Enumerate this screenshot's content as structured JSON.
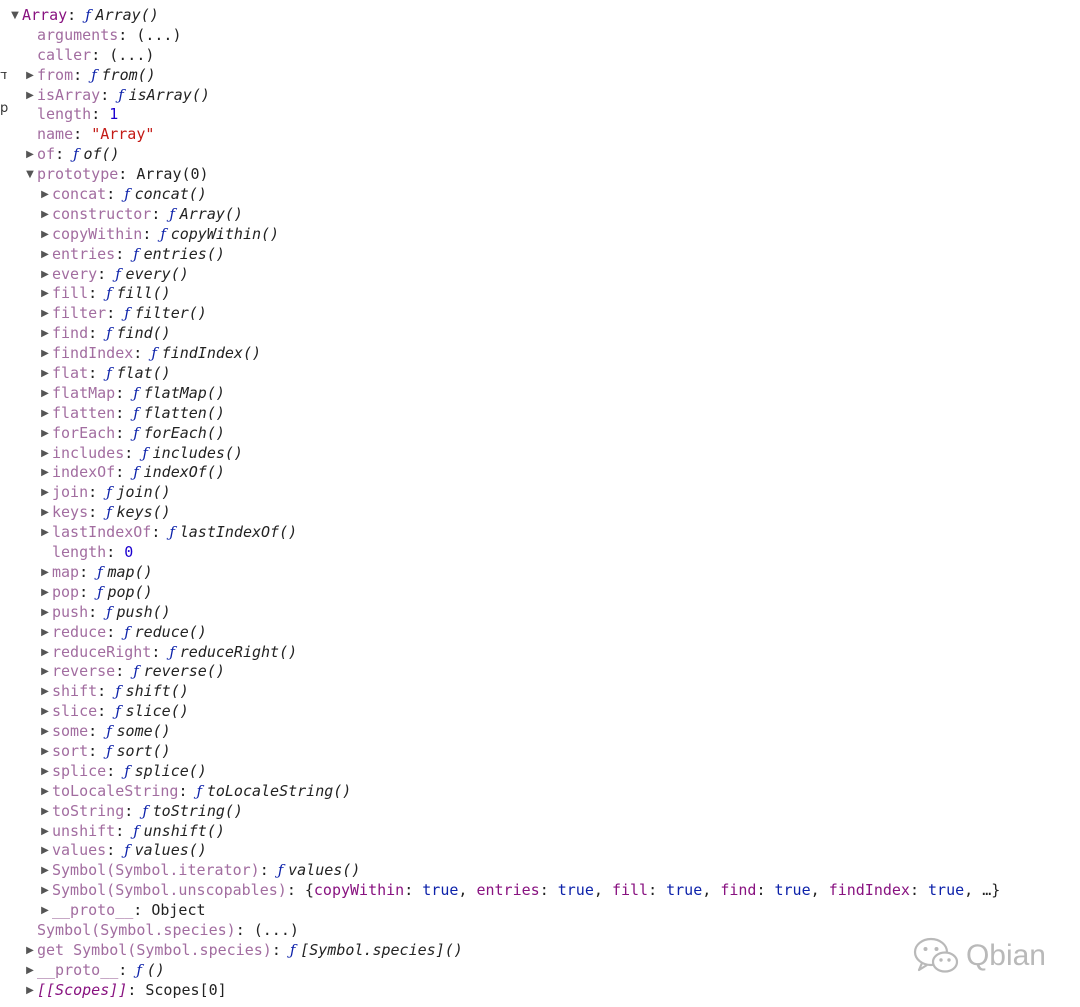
{
  "edge": [
    "ד",
    "p"
  ],
  "watermark": {
    "text": "Qbian",
    "icon": "wechat-icon"
  },
  "rows": [
    {
      "indent": 0,
      "arrow": "open",
      "key": "Array",
      "style": "enum",
      "value": [
        [
          "fsym",
          "ƒ "
        ],
        [
          "fname",
          "Array()"
        ]
      ]
    },
    {
      "indent": 1,
      "arrow": "none",
      "key": "arguments",
      "style": "nonenum",
      "value": [
        [
          "plain",
          "(...)"
        ]
      ]
    },
    {
      "indent": 1,
      "arrow": "none",
      "key": "caller",
      "style": "nonenum",
      "value": [
        [
          "plain",
          "(...)"
        ]
      ]
    },
    {
      "indent": 1,
      "arrow": "closed",
      "key": "from",
      "style": "nonenum",
      "value": [
        [
          "fsym",
          "ƒ "
        ],
        [
          "fname",
          "from()"
        ]
      ]
    },
    {
      "indent": 1,
      "arrow": "closed",
      "key": "isArray",
      "style": "nonenum",
      "value": [
        [
          "fsym",
          "ƒ "
        ],
        [
          "fname",
          "isArray()"
        ]
      ]
    },
    {
      "indent": 1,
      "arrow": "none",
      "key": "length",
      "style": "nonenum",
      "value": [
        [
          "num",
          "1"
        ]
      ]
    },
    {
      "indent": 1,
      "arrow": "none",
      "key": "name",
      "style": "nonenum",
      "value": [
        [
          "str",
          "\"Array\""
        ]
      ]
    },
    {
      "indent": 1,
      "arrow": "closed",
      "key": "of",
      "style": "nonenum",
      "value": [
        [
          "fsym",
          "ƒ "
        ],
        [
          "fname",
          "of()"
        ]
      ]
    },
    {
      "indent": 1,
      "arrow": "open",
      "key": "prototype",
      "style": "nonenum",
      "value": [
        [
          "plain",
          "Array(0)"
        ]
      ]
    },
    {
      "indent": 2,
      "arrow": "closed",
      "key": "concat",
      "style": "nonenum",
      "value": [
        [
          "fsym",
          "ƒ "
        ],
        [
          "fname",
          "concat()"
        ]
      ]
    },
    {
      "indent": 2,
      "arrow": "closed",
      "key": "constructor",
      "style": "nonenum",
      "value": [
        [
          "fsym",
          "ƒ "
        ],
        [
          "fname",
          "Array()"
        ]
      ]
    },
    {
      "indent": 2,
      "arrow": "closed",
      "key": "copyWithin",
      "style": "nonenum",
      "value": [
        [
          "fsym",
          "ƒ "
        ],
        [
          "fname",
          "copyWithin()"
        ]
      ]
    },
    {
      "indent": 2,
      "arrow": "closed",
      "key": "entries",
      "style": "nonenum",
      "value": [
        [
          "fsym",
          "ƒ "
        ],
        [
          "fname",
          "entries()"
        ]
      ]
    },
    {
      "indent": 2,
      "arrow": "closed",
      "key": "every",
      "style": "nonenum",
      "value": [
        [
          "fsym",
          "ƒ "
        ],
        [
          "fname",
          "every()"
        ]
      ]
    },
    {
      "indent": 2,
      "arrow": "closed",
      "key": "fill",
      "style": "nonenum",
      "value": [
        [
          "fsym",
          "ƒ "
        ],
        [
          "fname",
          "fill()"
        ]
      ]
    },
    {
      "indent": 2,
      "arrow": "closed",
      "key": "filter",
      "style": "nonenum",
      "value": [
        [
          "fsym",
          "ƒ "
        ],
        [
          "fname",
          "filter()"
        ]
      ]
    },
    {
      "indent": 2,
      "arrow": "closed",
      "key": "find",
      "style": "nonenum",
      "value": [
        [
          "fsym",
          "ƒ "
        ],
        [
          "fname",
          "find()"
        ]
      ]
    },
    {
      "indent": 2,
      "arrow": "closed",
      "key": "findIndex",
      "style": "nonenum",
      "value": [
        [
          "fsym",
          "ƒ "
        ],
        [
          "fname",
          "findIndex()"
        ]
      ]
    },
    {
      "indent": 2,
      "arrow": "closed",
      "key": "flat",
      "style": "nonenum",
      "value": [
        [
          "fsym",
          "ƒ "
        ],
        [
          "fname",
          "flat()"
        ]
      ]
    },
    {
      "indent": 2,
      "arrow": "closed",
      "key": "flatMap",
      "style": "nonenum",
      "value": [
        [
          "fsym",
          "ƒ "
        ],
        [
          "fname",
          "flatMap()"
        ]
      ]
    },
    {
      "indent": 2,
      "arrow": "closed",
      "key": "flatten",
      "style": "nonenum",
      "value": [
        [
          "fsym",
          "ƒ "
        ],
        [
          "fname",
          "flatten()"
        ]
      ]
    },
    {
      "indent": 2,
      "arrow": "closed",
      "key": "forEach",
      "style": "nonenum",
      "value": [
        [
          "fsym",
          "ƒ "
        ],
        [
          "fname",
          "forEach()"
        ]
      ]
    },
    {
      "indent": 2,
      "arrow": "closed",
      "key": "includes",
      "style": "nonenum",
      "value": [
        [
          "fsym",
          "ƒ "
        ],
        [
          "fname",
          "includes()"
        ]
      ]
    },
    {
      "indent": 2,
      "arrow": "closed",
      "key": "indexOf",
      "style": "nonenum",
      "value": [
        [
          "fsym",
          "ƒ "
        ],
        [
          "fname",
          "indexOf()"
        ]
      ]
    },
    {
      "indent": 2,
      "arrow": "closed",
      "key": "join",
      "style": "nonenum",
      "value": [
        [
          "fsym",
          "ƒ "
        ],
        [
          "fname",
          "join()"
        ]
      ]
    },
    {
      "indent": 2,
      "arrow": "closed",
      "key": "keys",
      "style": "nonenum",
      "value": [
        [
          "fsym",
          "ƒ "
        ],
        [
          "fname",
          "keys()"
        ]
      ]
    },
    {
      "indent": 2,
      "arrow": "closed",
      "key": "lastIndexOf",
      "style": "nonenum",
      "value": [
        [
          "fsym",
          "ƒ "
        ],
        [
          "fname",
          "lastIndexOf()"
        ]
      ]
    },
    {
      "indent": 2,
      "arrow": "none",
      "key": "length",
      "style": "nonenum",
      "value": [
        [
          "num",
          "0"
        ]
      ]
    },
    {
      "indent": 2,
      "arrow": "closed",
      "key": "map",
      "style": "nonenum",
      "value": [
        [
          "fsym",
          "ƒ "
        ],
        [
          "fname",
          "map()"
        ]
      ]
    },
    {
      "indent": 2,
      "arrow": "closed",
      "key": "pop",
      "style": "nonenum",
      "value": [
        [
          "fsym",
          "ƒ "
        ],
        [
          "fname",
          "pop()"
        ]
      ]
    },
    {
      "indent": 2,
      "arrow": "closed",
      "key": "push",
      "style": "nonenum",
      "value": [
        [
          "fsym",
          "ƒ "
        ],
        [
          "fname",
          "push()"
        ]
      ]
    },
    {
      "indent": 2,
      "arrow": "closed",
      "key": "reduce",
      "style": "nonenum",
      "value": [
        [
          "fsym",
          "ƒ "
        ],
        [
          "fname",
          "reduce()"
        ]
      ]
    },
    {
      "indent": 2,
      "arrow": "closed",
      "key": "reduceRight",
      "style": "nonenum",
      "value": [
        [
          "fsym",
          "ƒ "
        ],
        [
          "fname",
          "reduceRight()"
        ]
      ]
    },
    {
      "indent": 2,
      "arrow": "closed",
      "key": "reverse",
      "style": "nonenum",
      "value": [
        [
          "fsym",
          "ƒ "
        ],
        [
          "fname",
          "reverse()"
        ]
      ]
    },
    {
      "indent": 2,
      "arrow": "closed",
      "key": "shift",
      "style": "nonenum",
      "value": [
        [
          "fsym",
          "ƒ "
        ],
        [
          "fname",
          "shift()"
        ]
      ]
    },
    {
      "indent": 2,
      "arrow": "closed",
      "key": "slice",
      "style": "nonenum",
      "value": [
        [
          "fsym",
          "ƒ "
        ],
        [
          "fname",
          "slice()"
        ]
      ]
    },
    {
      "indent": 2,
      "arrow": "closed",
      "key": "some",
      "style": "nonenum",
      "value": [
        [
          "fsym",
          "ƒ "
        ],
        [
          "fname",
          "some()"
        ]
      ]
    },
    {
      "indent": 2,
      "arrow": "closed",
      "key": "sort",
      "style": "nonenum",
      "value": [
        [
          "fsym",
          "ƒ "
        ],
        [
          "fname",
          "sort()"
        ]
      ]
    },
    {
      "indent": 2,
      "arrow": "closed",
      "key": "splice",
      "style": "nonenum",
      "value": [
        [
          "fsym",
          "ƒ "
        ],
        [
          "fname",
          "splice()"
        ]
      ]
    },
    {
      "indent": 2,
      "arrow": "closed",
      "key": "toLocaleString",
      "style": "nonenum",
      "value": [
        [
          "fsym",
          "ƒ "
        ],
        [
          "fname",
          "toLocaleString()"
        ]
      ]
    },
    {
      "indent": 2,
      "arrow": "closed",
      "key": "toString",
      "style": "nonenum",
      "value": [
        [
          "fsym",
          "ƒ "
        ],
        [
          "fname",
          "toString()"
        ]
      ]
    },
    {
      "indent": 2,
      "arrow": "closed",
      "key": "unshift",
      "style": "nonenum",
      "value": [
        [
          "fsym",
          "ƒ "
        ],
        [
          "fname",
          "unshift()"
        ]
      ]
    },
    {
      "indent": 2,
      "arrow": "closed",
      "key": "values",
      "style": "nonenum",
      "value": [
        [
          "fsym",
          "ƒ "
        ],
        [
          "fname",
          "values()"
        ]
      ]
    },
    {
      "indent": 2,
      "arrow": "closed",
      "key": "Symbol(Symbol.iterator)",
      "style": "nonenum",
      "value": [
        [
          "fsym",
          "ƒ "
        ],
        [
          "fname",
          "values()"
        ]
      ]
    },
    {
      "indent": 2,
      "arrow": "closed",
      "key": "Symbol(Symbol.unscopables)",
      "style": "nonenum",
      "value": [
        [
          "plain",
          "{"
        ],
        [
          "key",
          "copyWithin"
        ],
        [
          "plain",
          ": "
        ],
        [
          "kw",
          "true"
        ],
        [
          "plain",
          ", "
        ],
        [
          "key",
          "entries"
        ],
        [
          "plain",
          ": "
        ],
        [
          "kw",
          "true"
        ],
        [
          "plain",
          ", "
        ],
        [
          "key",
          "fill"
        ],
        [
          "plain",
          ": "
        ],
        [
          "kw",
          "true"
        ],
        [
          "plain",
          ", "
        ],
        [
          "key",
          "find"
        ],
        [
          "plain",
          ": "
        ],
        [
          "kw",
          "true"
        ],
        [
          "plain",
          ", "
        ],
        [
          "key",
          "findIndex"
        ],
        [
          "plain",
          ": "
        ],
        [
          "kw",
          "true"
        ],
        [
          "plain",
          ", …}"
        ]
      ]
    },
    {
      "indent": 2,
      "arrow": "closed",
      "key": "__proto__",
      "style": "nonenum",
      "value": [
        [
          "plain",
          "Object"
        ]
      ]
    },
    {
      "indent": 1,
      "arrow": "none",
      "key": "Symbol(Symbol.species)",
      "style": "nonenum",
      "value": [
        [
          "plain",
          "(...)"
        ]
      ]
    },
    {
      "indent": 1,
      "arrow": "closed",
      "key": "get Symbol(Symbol.species)",
      "style": "nonenum",
      "value": [
        [
          "fsym",
          "ƒ "
        ],
        [
          "fname",
          "[Symbol.species]()"
        ]
      ]
    },
    {
      "indent": 1,
      "arrow": "closed",
      "key": "__proto__",
      "style": "nonenum",
      "value": [
        [
          "fsym",
          "ƒ "
        ],
        [
          "fname",
          "()"
        ]
      ]
    },
    {
      "indent": 1,
      "arrow": "closed",
      "key": "[[Scopes]]",
      "style": "internal",
      "value": [
        [
          "plain",
          "Scopes[0]"
        ]
      ]
    }
  ]
}
